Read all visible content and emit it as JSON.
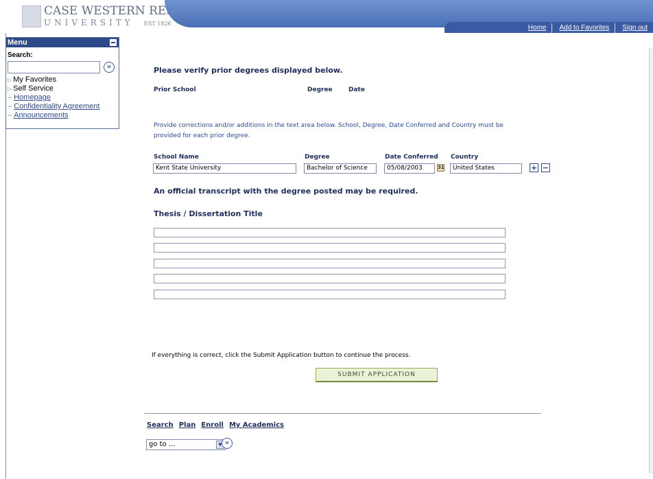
{
  "header": {
    "logo_name": "CASE WESTERN RESERVE",
    "logo_sub": "UNIVERSITY",
    "logo_est": "EST 1826",
    "links": [
      "Home",
      "Add to Favorites",
      "Sign out"
    ]
  },
  "menu": {
    "title": "Menu",
    "search_label": "Search:",
    "search_value": "",
    "items": [
      {
        "label": "My Favorites",
        "type": "folder"
      },
      {
        "label": "Self Service",
        "type": "folder"
      },
      {
        "label": "Homepage",
        "type": "link"
      },
      {
        "label": "Confidentiality Agreement",
        "type": "link"
      },
      {
        "label": "Announcements",
        "type": "link"
      }
    ]
  },
  "main": {
    "verify_title": "Please verify prior degrees displayed below.",
    "prior_headers": {
      "school": "Prior School",
      "degree": "Degree",
      "date": "Date"
    },
    "corrections_note": "Provide corrections and/or additions in the text area below. School, Degree, Date Conferred and Country must be provided for each prior degree.",
    "entry_headers": {
      "school": "School Name",
      "degree": "Degree",
      "date": "Date Conferred",
      "country": "Country"
    },
    "entry": {
      "school": "Kent State University",
      "degree": "Bachelor of Science",
      "date": "05/08/2003",
      "country": "United States"
    },
    "calendar_icon_text": "31",
    "official_note": "An official transcript with the degree posted may be required.",
    "thesis_title": "Thesis / Dissertation Title",
    "thesis_lines": [
      "",
      "",
      "",
      "",
      ""
    ],
    "instruction": "If everything is correct, click the Submit Application button to continue the process.",
    "submit_label": "Submit Application"
  },
  "footer": {
    "links": [
      "Search",
      "Plan",
      "Enroll",
      "My Academics"
    ],
    "goto_value": "go to ..."
  }
}
